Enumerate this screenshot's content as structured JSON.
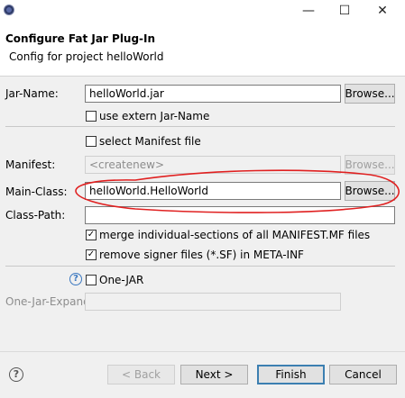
{
  "window": {
    "minimize": "—",
    "maximize": "☐",
    "close": "✕"
  },
  "banner": {
    "title": "Configure Fat Jar Plug-In",
    "subtitle": "Config for project helloWorld"
  },
  "form": {
    "jar_name": {
      "label": "Jar-Name:",
      "value": "helloWorld.jar",
      "browse": "Browse..."
    },
    "use_extern": {
      "label": "use extern Jar-Name",
      "checked": false
    },
    "select_manifest": {
      "label": "select Manifest file",
      "checked": false
    },
    "manifest": {
      "label": "Manifest:",
      "value": "<createnew>",
      "browse": "Browse..."
    },
    "main_class": {
      "label": "Main-Class:",
      "value": "helloWorld.HelloWorld",
      "browse": "Browse..."
    },
    "class_path": {
      "label": "Class-Path:",
      "value": ""
    },
    "merge_manifest": {
      "label": "merge individual-sections of all MANIFEST.MF files",
      "checked": true
    },
    "remove_signer": {
      "label": "remove signer files (*.SF) in META-INF",
      "checked": true
    },
    "one_jar": {
      "label": "One-JAR",
      "checked": false
    },
    "one_jar_expand": {
      "label": "One-Jar-Expand:",
      "value": ""
    }
  },
  "footer": {
    "back": "< Back",
    "next": "Next >",
    "finish": "Finish",
    "cancel": "Cancel"
  },
  "annotation_color": "#e02020"
}
